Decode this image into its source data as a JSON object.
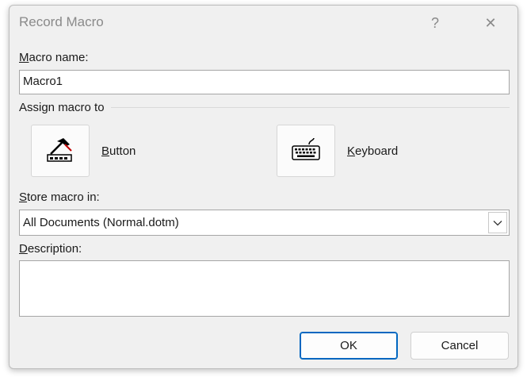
{
  "dialog": {
    "title": "Record Macro",
    "help_glyph": "?",
    "close_glyph": "✕"
  },
  "macro_name": {
    "label_ul": "M",
    "label_rest": "acro name:",
    "value": "Macro1"
  },
  "assign": {
    "label": "Assign macro to",
    "button": {
      "label_ul": "B",
      "label_rest": "utton",
      "icon": "hammer-button-icon"
    },
    "keyboard": {
      "label_ul": "K",
      "label_rest": "eyboard",
      "icon": "keyboard-icon"
    }
  },
  "store": {
    "label_ul": "S",
    "label_rest": "tore macro in:",
    "selected": "All Documents (Normal.dotm)"
  },
  "description": {
    "label_ul": "D",
    "label_rest": "escription:",
    "value": ""
  },
  "footer": {
    "ok": "OK",
    "cancel": "Cancel"
  }
}
